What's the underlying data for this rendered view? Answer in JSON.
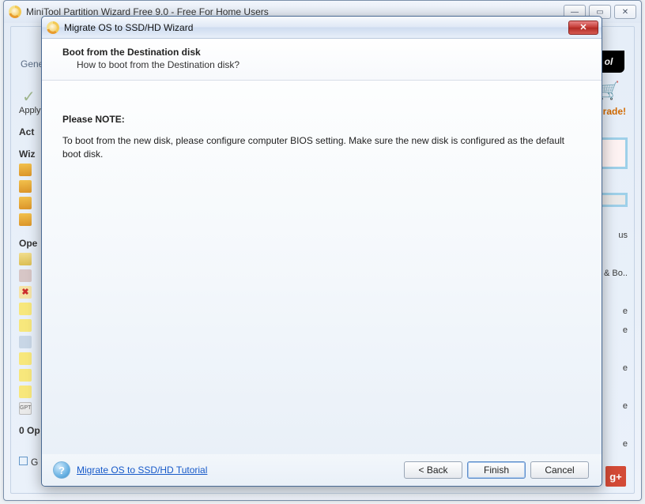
{
  "outer": {
    "title": "MiniTool Partition Wizard Free 9.0 - Free For Home Users",
    "controls": {
      "min": "—",
      "max": "▭",
      "close": "✕"
    },
    "logoText": "ol",
    "upgrade": "grade!",
    "left": {
      "menu0": "Gene",
      "apply": "Apply",
      "actions": "Act",
      "wizards": "Wiz",
      "operations": "Ope",
      "pending": "0 Op",
      "gLabel": "G",
      "gptLabel": "GPT"
    },
    "right": {
      "us": "us",
      "ebo": "e & Bo..",
      "e1": "e",
      "e2": "e",
      "e3": "e",
      "e4": "e",
      "e5": "e"
    },
    "gplus": "g+",
    "cart": "🛒"
  },
  "dialog": {
    "title": "Migrate OS to SSD/HD Wizard",
    "head": {
      "title": "Boot from the Destination disk",
      "sub": "How to boot from the Destination disk?"
    },
    "body": {
      "noteHeading": "Please NOTE:",
      "noteText": "To boot from the new disk, please configure computer BIOS setting. Make sure the new disk is configured as the default boot disk."
    },
    "footer": {
      "helpGlyph": "?",
      "tutorial": "Migrate OS to SSD/HD Tutorial",
      "back": "< Back",
      "finish": "Finish",
      "cancel": "Cancel"
    },
    "closeGlyph": "✕"
  }
}
